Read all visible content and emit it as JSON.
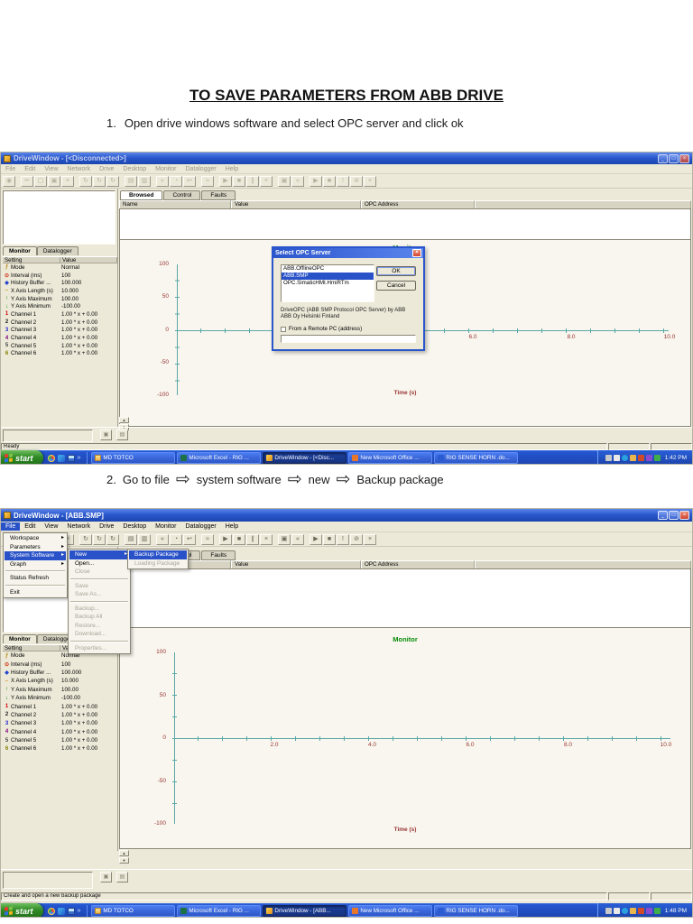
{
  "colors": {
    "titlebar_blue": "#2a57cc",
    "menu_highlight_blue": "#2a52c8",
    "monitor_title_green": "#0a8a0a",
    "axis_teal": "#5aa8a8",
    "axis_label_red": "#9a3434",
    "window_bg": "#ece9d8",
    "taskbar_blue": "#2456cf",
    "start_button_green": "#2f8a24",
    "close_button_red": "#cf4431"
  },
  "document": {
    "title": "TO SAVE PARAMETERS FROM ABB DRIVE",
    "step1_num": "1.",
    "step1_text": "Open drive windows software and select OPC server and click ok",
    "step2_num": "2.",
    "step2_parts": [
      "Go to file",
      "system software",
      "new",
      "Backup package"
    ]
  },
  "toolbar": {
    "buttons": [
      {
        "g": "◉"
      },
      {
        "g": "✂",
        "gap": true
      },
      {
        "g": "▢"
      },
      {
        "g": "▣"
      },
      {
        "g": "×"
      },
      {
        "g": "↻",
        "gap": true
      },
      {
        "g": "↻"
      },
      {
        "g": "↻"
      },
      {
        "g": "▤",
        "gap": true
      },
      {
        "g": "▥"
      },
      {
        "g": "«",
        "gap": true
      },
      {
        "g": "◔"
      },
      {
        "g": "↩"
      },
      {
        "g": "≈",
        "gap": true
      },
      {
        "g": "▶",
        "gap": true
      },
      {
        "g": "■"
      },
      {
        "g": "∥"
      },
      {
        "g": "×"
      },
      {
        "g": "▣",
        "gap": true
      },
      {
        "g": "«"
      },
      {
        "g": "▶",
        "gap": true
      },
      {
        "g": "■"
      },
      {
        "g": "!"
      },
      {
        "g": "⊘"
      },
      {
        "g": "×"
      }
    ]
  },
  "panel": {
    "tabs": [
      {
        "label": "Monitor",
        "active": true
      },
      {
        "label": "Datalogger"
      }
    ],
    "header": [
      "Setting",
      "Value"
    ],
    "settings": [
      {
        "icon": "ƒ",
        "cls": "ic-mode",
        "name": "Mode",
        "value": "Normal"
      },
      {
        "icon": "⊙",
        "cls": "ic-clock",
        "name": "Interval (ms)",
        "value": "100"
      },
      {
        "icon": "◆",
        "cls": "ic-buffer",
        "name": "History Buffer ...",
        "value": "100.000"
      },
      {
        "icon": "⇔",
        "cls": "ic-xaxis",
        "name": "X Axis Length (s)",
        "value": "10.000"
      },
      {
        "icon": "↑",
        "cls": "ic-ymax",
        "name": "Y Axis Maximum",
        "value": "100.00"
      },
      {
        "icon": "↓",
        "cls": "ic-ymin",
        "name": "Y Axis Minimum",
        "value": "-100.00"
      },
      {
        "icon": "1",
        "cls": "ch1",
        "name": "Channel 1",
        "value": "1.00 * x + 0.00"
      },
      {
        "icon": "2",
        "cls": "ch2",
        "name": "Channel 2",
        "value": "1.00 * x + 0.00"
      },
      {
        "icon": "3",
        "cls": "ch3",
        "name": "Channel 3",
        "value": "1.00 * x + 0.00"
      },
      {
        "icon": "4",
        "cls": "ch4",
        "name": "Channel 4",
        "value": "1.00 * x + 0.00"
      },
      {
        "icon": "5",
        "cls": "ch5",
        "name": "Channel 5",
        "value": "1.00 * x + 0.00"
      },
      {
        "icon": "6",
        "cls": "ch6",
        "name": "Channel 6",
        "value": "1.00 * x + 0.00"
      }
    ]
  },
  "browser": {
    "tabs": [
      {
        "label": "Browsed",
        "active": true
      },
      {
        "label": "Control"
      },
      {
        "label": "Faults"
      }
    ],
    "columns": [
      "Name",
      "Value",
      "OPC Address"
    ]
  },
  "chart": {
    "title": "Monitor",
    "y_ticks": [
      "100",
      "50",
      "0",
      "-50",
      "-100"
    ],
    "x_ticks": [
      "2.0",
      "4.0",
      "6.0",
      "8.0",
      "10.0"
    ],
    "xlabel": "Time (s)"
  },
  "chart_data": [
    {
      "type": "line",
      "title": "Monitor",
      "xlabel": "Time (s)",
      "ylabel": "",
      "xlim": [
        0,
        10
      ],
      "ylim": [
        -100,
        100
      ],
      "x_ticks": [
        2.0,
        4.0,
        6.0,
        8.0,
        10.0
      ],
      "y_ticks": [
        100,
        50,
        0,
        -50,
        -100
      ],
      "series": [],
      "grid": false,
      "legend": false,
      "note": "Empty monitor plot in screenshot 1 - no data traces"
    },
    {
      "type": "line",
      "title": "Monitor",
      "xlabel": "Time (s)",
      "ylabel": "",
      "xlim": [
        0,
        10
      ],
      "ylim": [
        -100,
        100
      ],
      "x_ticks": [
        2.0,
        4.0,
        6.0,
        8.0,
        10.0
      ],
      "y_ticks": [
        100,
        50,
        0,
        -50,
        -100
      ],
      "series": [],
      "grid": false,
      "legend": false,
      "note": "Empty monitor plot in screenshot 2 - no data traces"
    }
  ],
  "shot1": {
    "window_title": "DriveWindow - [<Disconnected>]",
    "menu": [
      {
        "label": "File"
      },
      {
        "label": "Edit"
      },
      {
        "label": "View"
      },
      {
        "label": "Network"
      },
      {
        "label": "Drive"
      },
      {
        "label": "Desktop"
      },
      {
        "label": "Monitor"
      },
      {
        "label": "Datalogger"
      },
      {
        "label": "Help"
      }
    ],
    "dialog": {
      "title": "Select OPC Server",
      "items": [
        {
          "label": "ABB.OfflineOPC"
        },
        {
          "label": "ABB.SMP",
          "selected": true
        },
        {
          "label": "OPC.SimaticHMI.HmiRTm"
        }
      ],
      "ok_label": "OK",
      "cancel_label": "Cancel",
      "desc_line1": "DriveOPC (ABB SMP Protocol OPC Server) by ABB",
      "desc_line2": "ABB Oy Helsinki Finland",
      "checkbox_label": "From a Remote PC (address)",
      "input_value": ""
    },
    "status": "Ready",
    "taskbar": {
      "start": "start",
      "items": [
        {
          "label": "MD TOTCO",
          "cls": "tb-fold"
        },
        {
          "label": "Microsoft Excel - RIG ...",
          "cls": "tb-excel"
        },
        {
          "label": "DriveWindow - [<Disc...",
          "cls": "tb-dw",
          "active": true
        },
        {
          "label": "New Microsoft Office ...",
          "cls": "tb-off"
        },
        {
          "label": "RIG SENSE HORN .do...",
          "cls": "tb-word"
        }
      ],
      "time": "1:42 PM"
    }
  },
  "shot2": {
    "window_title": "DriveWindow - [ABB.SMP]",
    "menu": [
      {
        "label": "File",
        "active": true
      },
      {
        "label": "Edit"
      },
      {
        "label": "View"
      },
      {
        "label": "Network"
      },
      {
        "label": "Drive"
      },
      {
        "label": "Desktop"
      },
      {
        "label": "Monitor"
      },
      {
        "label": "Datalogger"
      },
      {
        "label": "Help"
      }
    ],
    "file_menu": [
      {
        "label": "Workspace",
        "arrow": true
      },
      {
        "label": "Parameters",
        "arrow": true
      },
      {
        "label": "System Software",
        "arrow": true,
        "hl": true
      },
      {
        "label": "Graph",
        "arrow": true
      },
      {
        "sep": true
      },
      {
        "label": "Status Refresh"
      },
      {
        "sep": true
      },
      {
        "label": "Exit"
      }
    ],
    "system_menu": [
      {
        "label": "New",
        "arrow": true,
        "hl": true
      },
      {
        "label": "Open..."
      },
      {
        "label": "Close",
        "dis": true
      },
      {
        "sep": true
      },
      {
        "label": "Save",
        "dis": true
      },
      {
        "label": "Save As...",
        "dis": true
      },
      {
        "sep": true
      },
      {
        "label": "Backup...",
        "dis": true
      },
      {
        "label": "Backup All",
        "dis": true
      },
      {
        "label": "Restore...",
        "dis": true
      },
      {
        "label": "Download...",
        "dis": true
      },
      {
        "sep": true
      },
      {
        "label": "Properties...",
        "dis": true
      }
    ],
    "new_menu": [
      {
        "label": "Backup Package",
        "hl": true
      },
      {
        "label": "Loading Package",
        "dis": true
      }
    ],
    "status": "Create and open a new backup package",
    "taskbar": {
      "start": "start",
      "items": [
        {
          "label": "MD TOTCO",
          "cls": "tb-fold"
        },
        {
          "label": "Microsoft Excel - RIG ...",
          "cls": "tb-excel"
        },
        {
          "label": "DriveWindow - [ABB...",
          "cls": "tb-dw",
          "active": true
        },
        {
          "label": "New Microsoft Office ...",
          "cls": "tb-off"
        },
        {
          "label": "RIG SENSE HORN .do...",
          "cls": "tb-word"
        }
      ],
      "time": "1:48 PM"
    }
  }
}
